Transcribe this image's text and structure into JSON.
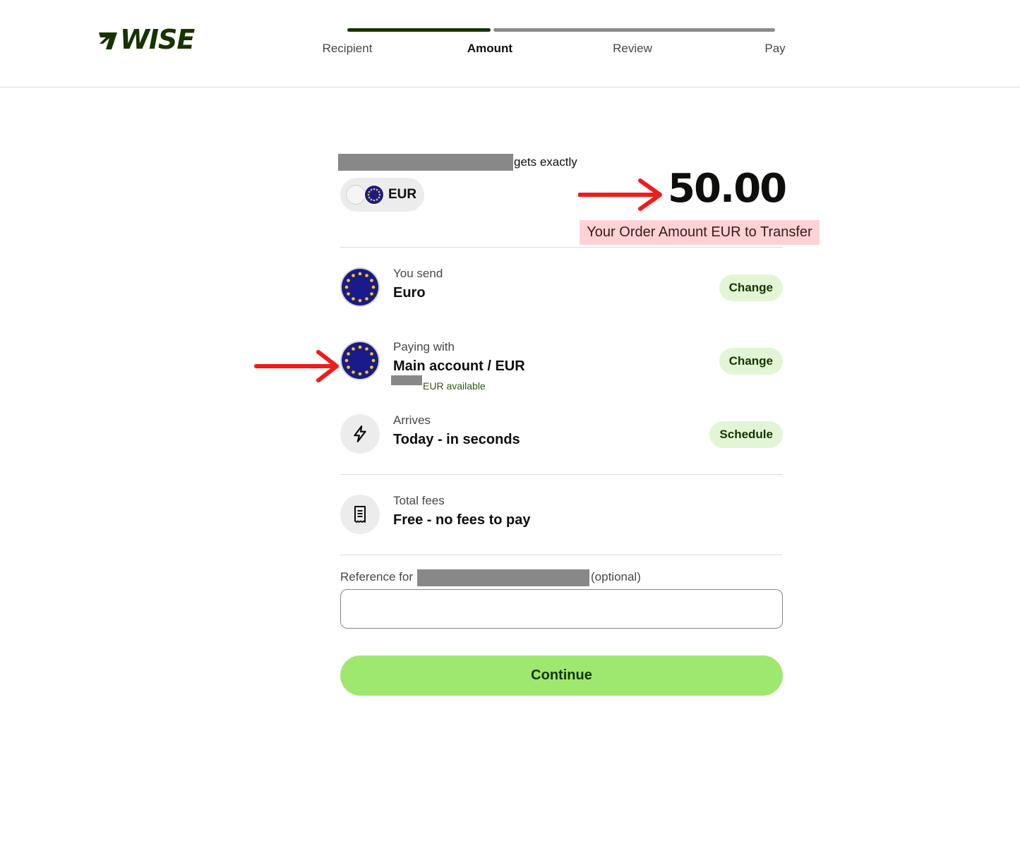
{
  "header": {
    "logo_text": "WISE",
    "steps": [
      {
        "label": "Recipient",
        "state": "done"
      },
      {
        "label": "Amount",
        "state": "active"
      },
      {
        "label": "Review",
        "state": "todo"
      },
      {
        "label": "Pay",
        "state": "todo"
      }
    ]
  },
  "recipient": {
    "gets_label": "gets exactly",
    "currency_code": "EUR",
    "amount": "50.00"
  },
  "annotation": {
    "label": "Your Order Amount EUR to Transfer"
  },
  "details": {
    "send": {
      "label": "You send",
      "value": "Euro",
      "button": "Change"
    },
    "paying": {
      "label": "Paying with",
      "value": "Main account / EUR",
      "available": "EUR available",
      "button": "Change"
    },
    "arrives": {
      "label": "Arrives",
      "value": "Today - in seconds",
      "button": "Schedule"
    },
    "fees": {
      "label": "Total fees",
      "value": "Free - no fees to pay"
    }
  },
  "reference": {
    "label": "Reference for",
    "optional": "(optional)",
    "value": ""
  },
  "continue_label": "Continue",
  "colors": {
    "brand_dark": "#163300",
    "brand_green": "#9fe870",
    "chip_green": "#e2f6d5",
    "annotation_red": "#ee1c1c",
    "eu_blue": "#1b1a8a",
    "eu_star": "#f5d000"
  }
}
